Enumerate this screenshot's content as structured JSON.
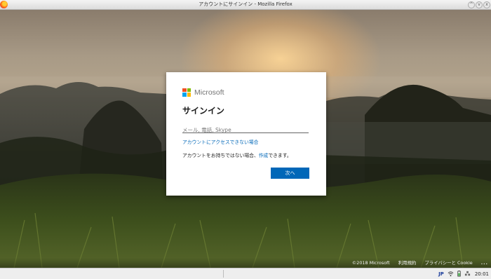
{
  "window": {
    "title": "アカウントにサインイン - Mozilla Firefox",
    "buttons": [
      "^",
      "v",
      "x"
    ]
  },
  "signin": {
    "brand": "Microsoft",
    "heading": "サインイン",
    "input_placeholder": "メール, 電話, Skype",
    "input_value": "",
    "access_link": "アカウントにアクセスできない場合",
    "no_account_prefix": "アカウントをお持ちではない場合、",
    "create_link": "作成",
    "no_account_suffix": "できます。",
    "next_button": "次へ",
    "logo_colors": [
      "#f25022",
      "#7fba00",
      "#00a4ef",
      "#ffb900"
    ]
  },
  "footer": {
    "copyright": "©2018 Microsoft",
    "terms": "利用規約",
    "privacy": "プライバシーと Cookie",
    "more": "..."
  },
  "taskbar": {
    "language": "JP",
    "time": "20:01"
  },
  "colors": {
    "accent": "#0067b8",
    "heading_text": "#1b1b1b"
  }
}
